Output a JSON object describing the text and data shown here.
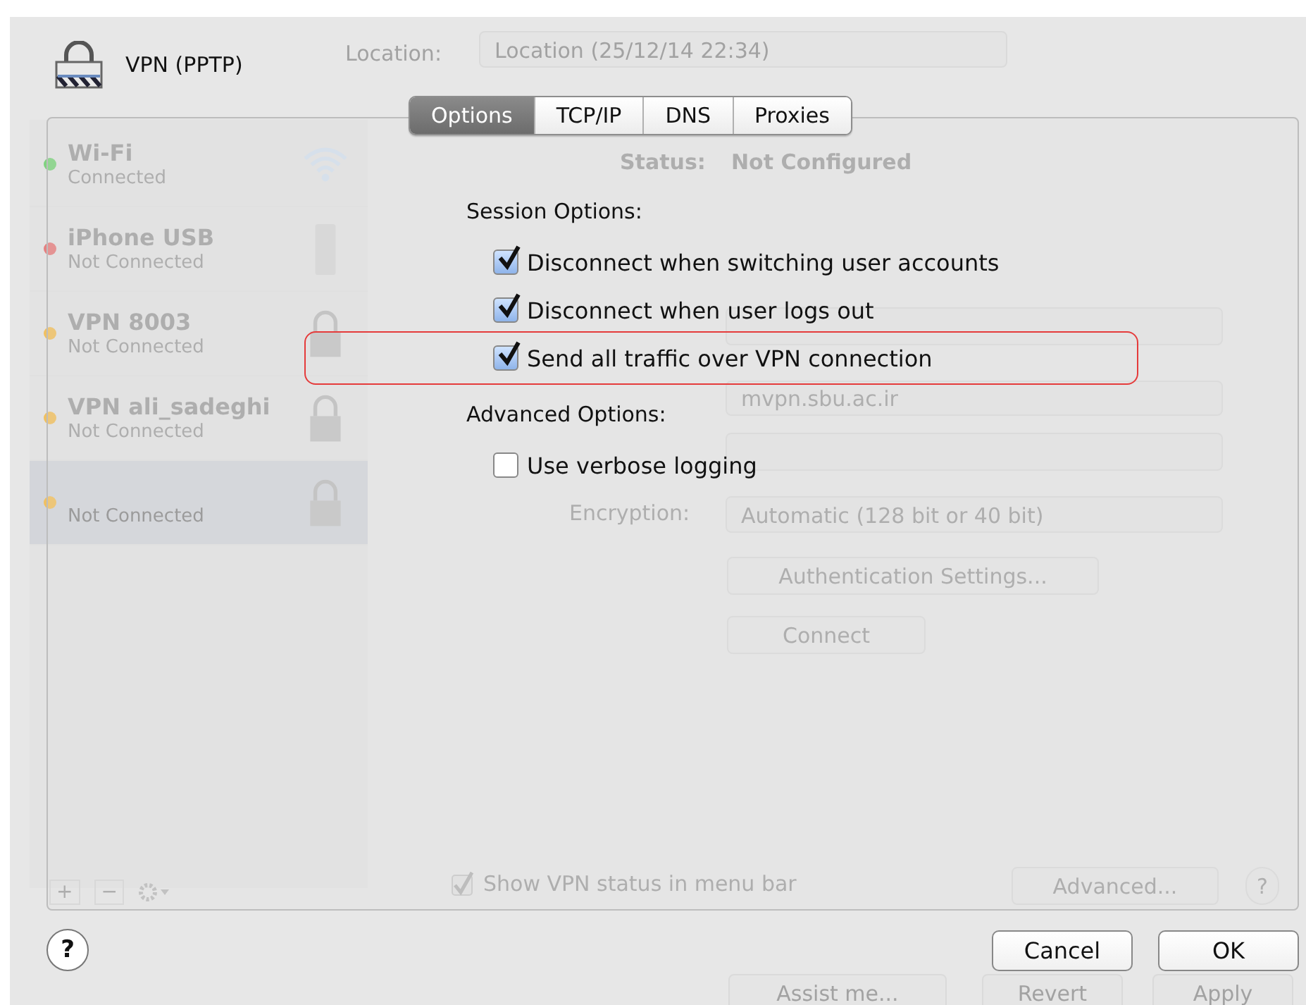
{
  "background_window": {
    "location_label": "Location:",
    "location_value": "Location (25/12/14 22:34)",
    "services": [
      {
        "name": "Wi-Fi",
        "status": "Connected",
        "color": "#7fd27f",
        "kind": "wifi",
        "selected": false
      },
      {
        "name": "iPhone USB",
        "status": "Not Connected",
        "color": "#e58080",
        "kind": "phone",
        "selected": false
      },
      {
        "name": "VPN 8003",
        "status": "Not Connected",
        "color": "#f0c060",
        "kind": "vpn",
        "selected": false
      },
      {
        "name": "VPN ali_sadeghi",
        "status": "Not Connected",
        "color": "#f0c060",
        "kind": "vpn",
        "selected": false
      },
      {
        "status": "Not Connected",
        "color": "#f0c060",
        "kind": "vpn",
        "selected": true
      }
    ],
    "status_label": "Status:",
    "status_value": "Not Configured",
    "server_address": "mvpn.sbu.ac.ir",
    "encryption_label": "Encryption:",
    "encryption_value": "Automatic (128 bit or 40 bit)",
    "authentication_button": "Authentication Settings...",
    "connect_button": "Connect",
    "show_status": {
      "label": "Show VPN status in menu bar",
      "checked": true
    },
    "advanced_button": "Advanced...",
    "help": "?",
    "list_controls": [
      "+",
      "−"
    ],
    "footer_buttons": [
      "Assist me...",
      "Revert",
      "Apply"
    ]
  },
  "sheet": {
    "title": "VPN (PPTP)",
    "tabs": [
      {
        "label": "Options",
        "selected": true
      },
      {
        "label": "TCP/IP",
        "selected": false
      },
      {
        "label": "DNS",
        "selected": false
      },
      {
        "label": "Proxies",
        "selected": false
      }
    ],
    "sections": [
      {
        "heading": "Session Options:",
        "options": [
          {
            "label": "Disconnect when switching user accounts",
            "checked": true,
            "highlighted": false
          },
          {
            "label": "Disconnect when user logs out",
            "checked": true,
            "highlighted": false
          },
          {
            "label": "Send all traffic over VPN connection",
            "checked": true,
            "highlighted": true
          }
        ]
      },
      {
        "heading": "Advanced Options:",
        "options": [
          {
            "label": "Use verbose logging",
            "checked": false,
            "highlighted": false
          }
        ]
      }
    ],
    "help": "?",
    "buttons": [
      "Cancel",
      "OK"
    ]
  }
}
